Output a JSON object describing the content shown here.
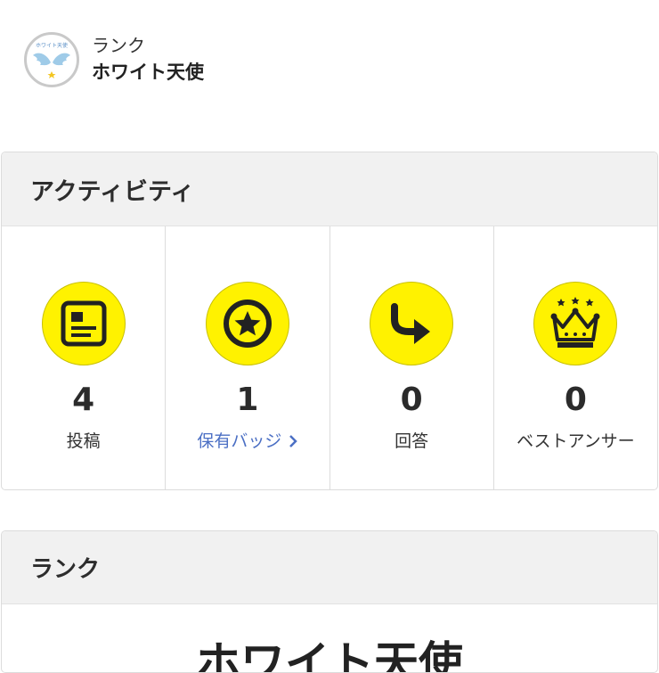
{
  "rank_header": {
    "caption": "ランク",
    "name": "ホワイト天使",
    "badge_text": "ホワイト天使",
    "badge_icon": "angel-wings-icon"
  },
  "activity": {
    "title": "アクティビティ",
    "stats": [
      {
        "icon": "article-icon",
        "value": "4",
        "label": "投稿",
        "link": false
      },
      {
        "icon": "star-badge-icon",
        "value": "1",
        "label": "保有バッジ",
        "link": true
      },
      {
        "icon": "reply-arrow-icon",
        "value": "0",
        "label": "回答",
        "link": false
      },
      {
        "icon": "crown-icon",
        "value": "0",
        "label": "ベストアンサー",
        "link": false
      }
    ]
  },
  "rank_section": {
    "title": "ランク",
    "rank_name": "ホワイト天使"
  },
  "colors": {
    "icon_circle": "#fff200",
    "link": "#4b6fc4",
    "card_header_bg": "#f1f1f1"
  }
}
